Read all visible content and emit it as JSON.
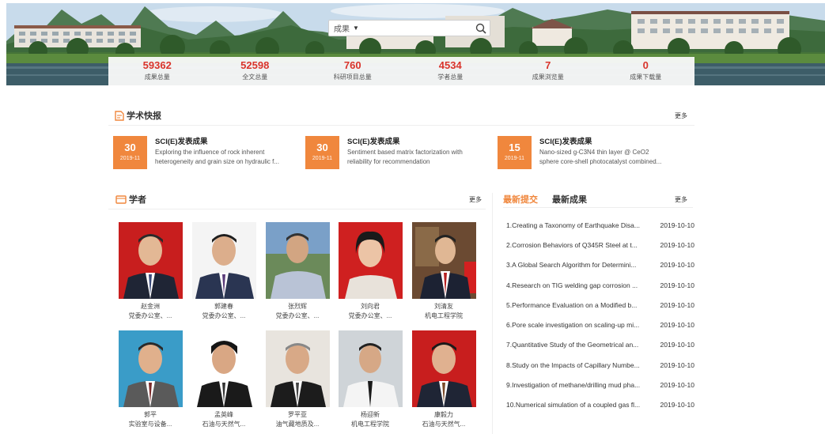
{
  "search": {
    "scope": "成果",
    "placeholder": ""
  },
  "stats": [
    {
      "value": "59362",
      "label": "成果总量"
    },
    {
      "value": "52598",
      "label": "全文总量"
    },
    {
      "value": "760",
      "label": "科研项目总量"
    },
    {
      "value": "4534",
      "label": "学者总量"
    },
    {
      "value": "7",
      "label": "成果浏览量"
    },
    {
      "value": "0",
      "label": "成果下载量"
    }
  ],
  "news_section": {
    "title": "学术快报",
    "more": "更多"
  },
  "news": [
    {
      "day": "30",
      "month": "2019-11",
      "title": "SCI(E)发表成果",
      "line1": "Exploring the influence of rock inherent",
      "line2": "heterogeneity and grain size on hydraulic f..."
    },
    {
      "day": "30",
      "month": "2019-11",
      "title": "SCI(E)发表成果",
      "line1": "Sentiment based matrix factorization with",
      "line2": "reliability for recommendation"
    },
    {
      "day": "15",
      "month": "2019-11",
      "title": "SCI(E)发表成果",
      "line1": "Nano-sized g-C3N4 thin layer @ CeO2",
      "line2": "sphere core-shell photocatalyst combined..."
    }
  ],
  "scholars_section": {
    "title": "学者",
    "more": "更多"
  },
  "scholars": [
    {
      "name": "赵金洲",
      "dept": "党委办公室、..."
    },
    {
      "name": "郭建春",
      "dept": "党委办公室、..."
    },
    {
      "name": "张烈辉",
      "dept": "党委办公室、..."
    },
    {
      "name": "刘向君",
      "dept": "党委办公室、..."
    },
    {
      "name": "刘清友",
      "dept": "机电工程学院"
    },
    {
      "name": "郭平",
      "dept": "实验室与设备..."
    },
    {
      "name": "孟英峰",
      "dept": "石油与天然气..."
    },
    {
      "name": "罗平亚",
      "dept": "油气藏地质及..."
    },
    {
      "name": "杨迎新",
      "dept": "机电工程学院"
    },
    {
      "name": "康毅力",
      "dept": "石油与天然气..."
    }
  ],
  "latest": {
    "tab_active": "最新提交",
    "tab_inactive": "最新成果",
    "more": "更多",
    "items": [
      {
        "title": "1.Creating a Taxonomy of Earthquake Disa...",
        "date": "2019-10-10"
      },
      {
        "title": "2.Corrosion Behaviors of Q345R Steel at t...",
        "date": "2019-10-10"
      },
      {
        "title": "3.A Global Search Algorithm for Determini...",
        "date": "2019-10-10"
      },
      {
        "title": "4.Research on TIG welding gap corrosion ...",
        "date": "2019-10-10"
      },
      {
        "title": "5.Performance Evaluation on a Modified b...",
        "date": "2019-10-10"
      },
      {
        "title": "6.Pore scale investigation on scaling-up mi...",
        "date": "2019-10-10"
      },
      {
        "title": "7.Quantitative Study of the Geometrical an...",
        "date": "2019-10-10"
      },
      {
        "title": "8.Study on the Impacts of Capillary Numbe...",
        "date": "2019-10-10"
      },
      {
        "title": "9.Investigation of methane/drilling mud pha...",
        "date": "2019-10-10"
      },
      {
        "title": "10.Numerical simulation of a coupled gas fl...",
        "date": "2019-10-10"
      }
    ]
  },
  "colors": {
    "accent": "#f0873d",
    "stat_number": "#d9342b"
  }
}
